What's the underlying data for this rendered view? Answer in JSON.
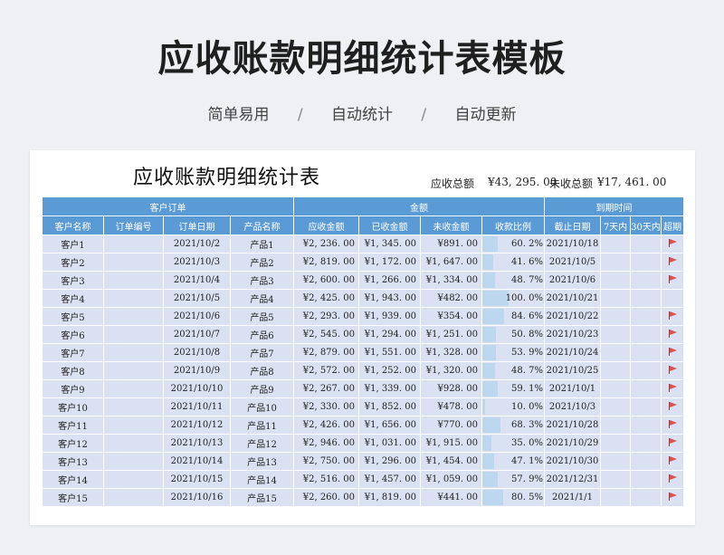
{
  "hero_title": "应收账款明细统计表模板",
  "subtitle": [
    "简单易用",
    "自动统计",
    "自动更新"
  ],
  "subtitle_sep": "/",
  "sheet": {
    "title": "应收账款明细统计表",
    "total_label": "应收总额",
    "total_value": "¥43, 295. 00",
    "unpaid_label": "未收总额",
    "unpaid_value": "¥17, 461. 00"
  },
  "groups": [
    "客户订单",
    "金额",
    "到期时间"
  ],
  "headers": [
    "客户名称",
    "订单编号",
    "订单日期",
    "产品名称",
    "应收金额",
    "已收金额",
    "未收金额",
    "收款比例",
    "截止日期",
    "7天内",
    "30天内",
    "超期"
  ],
  "colors": {
    "header_bg": "#5b9bd5",
    "row_bg": "#d9e1f2",
    "bar": "#bdd7ee",
    "flag": "#d9534f"
  },
  "rows": [
    {
      "customer": "客户1",
      "order_no": "",
      "date": "2021/10/2",
      "product": "产品1",
      "due": "¥2, 236. 00",
      "paid": "¥1, 345. 00",
      "unpaid": "¥891. 00",
      "ratio": "60. 2%",
      "ratio_value": 60.2,
      "deadline": "2021/10/18",
      "overdue": true
    },
    {
      "customer": "客户2",
      "order_no": "",
      "date": "2021/10/3",
      "product": "产品2",
      "due": "¥2, 819. 00",
      "paid": "¥1, 172. 00",
      "unpaid": "¥1, 647. 00",
      "ratio": "41. 6%",
      "ratio_value": 41.6,
      "deadline": "2021/10/5",
      "overdue": true
    },
    {
      "customer": "客户3",
      "order_no": "",
      "date": "2021/10/4",
      "product": "产品3",
      "due": "¥2, 600. 00",
      "paid": "¥1, 266. 00",
      "unpaid": "¥1, 334. 00",
      "ratio": "48. 7%",
      "ratio_value": 48.7,
      "deadline": "2021/10/6",
      "overdue": true
    },
    {
      "customer": "客户4",
      "order_no": "",
      "date": "2021/10/5",
      "product": "产品4",
      "due": "¥2, 425. 00",
      "paid": "¥1, 943. 00",
      "unpaid": "¥482. 00",
      "ratio": "100. 0%",
      "ratio_value": 100.0,
      "deadline": "2021/10/21",
      "overdue": false
    },
    {
      "customer": "客户5",
      "order_no": "",
      "date": "2021/10/6",
      "product": "产品5",
      "due": "¥2, 293. 00",
      "paid": "¥1, 939. 00",
      "unpaid": "¥354. 00",
      "ratio": "84. 6%",
      "ratio_value": 84.6,
      "deadline": "2021/10/22",
      "overdue": true
    },
    {
      "customer": "客户6",
      "order_no": "",
      "date": "2021/10/7",
      "product": "产品6",
      "due": "¥2, 545. 00",
      "paid": "¥1, 294. 00",
      "unpaid": "¥1, 251. 00",
      "ratio": "50. 8%",
      "ratio_value": 50.8,
      "deadline": "2021/10/23",
      "overdue": true
    },
    {
      "customer": "客户7",
      "order_no": "",
      "date": "2021/10/8",
      "product": "产品7",
      "due": "¥2, 879. 00",
      "paid": "¥1, 551. 00",
      "unpaid": "¥1, 328. 00",
      "ratio": "53. 9%",
      "ratio_value": 53.9,
      "deadline": "2021/10/24",
      "overdue": true
    },
    {
      "customer": "客户8",
      "order_no": "",
      "date": "2021/10/9",
      "product": "产品8",
      "due": "¥2, 572. 00",
      "paid": "¥1, 252. 00",
      "unpaid": "¥1, 320. 00",
      "ratio": "48. 7%",
      "ratio_value": 48.7,
      "deadline": "2021/10/25",
      "overdue": true
    },
    {
      "customer": "客户9",
      "order_no": "",
      "date": "2021/10/10",
      "product": "产品9",
      "due": "¥2, 267. 00",
      "paid": "¥1, 339. 00",
      "unpaid": "¥928. 00",
      "ratio": "59. 1%",
      "ratio_value": 59.1,
      "deadline": "2021/10/1",
      "overdue": true
    },
    {
      "customer": "客户10",
      "order_no": "",
      "date": "2021/10/11",
      "product": "产品10",
      "due": "¥2, 330. 00",
      "paid": "¥1, 852. 00",
      "unpaid": "¥478. 00",
      "ratio": "10. 0%",
      "ratio_value": 10.0,
      "deadline": "2021/10/3",
      "overdue": true
    },
    {
      "customer": "客户11",
      "order_no": "",
      "date": "2021/10/12",
      "product": "产品11",
      "due": "¥2, 426. 00",
      "paid": "¥1, 656. 00",
      "unpaid": "¥770. 00",
      "ratio": "68. 3%",
      "ratio_value": 68.3,
      "deadline": "2021/10/28",
      "overdue": true
    },
    {
      "customer": "客户12",
      "order_no": "",
      "date": "2021/10/13",
      "product": "产品12",
      "due": "¥2, 946. 00",
      "paid": "¥1, 031. 00",
      "unpaid": "¥1, 915. 00",
      "ratio": "35. 0%",
      "ratio_value": 35.0,
      "deadline": "2021/10/29",
      "overdue": true
    },
    {
      "customer": "客户13",
      "order_no": "",
      "date": "2021/10/14",
      "product": "产品13",
      "due": "¥2, 750. 00",
      "paid": "¥1, 296. 00",
      "unpaid": "¥1, 454. 00",
      "ratio": "47. 1%",
      "ratio_value": 47.1,
      "deadline": "2021/10/30",
      "overdue": true
    },
    {
      "customer": "客户14",
      "order_no": "",
      "date": "2021/10/15",
      "product": "产品14",
      "due": "¥2, 516. 00",
      "paid": "¥1, 457. 00",
      "unpaid": "¥1, 059. 00",
      "ratio": "57. 9%",
      "ratio_value": 57.9,
      "deadline": "2021/12/31",
      "overdue": true
    },
    {
      "customer": "客户15",
      "order_no": "",
      "date": "2021/10/16",
      "product": "产品15",
      "due": "¥2, 260. 00",
      "paid": "¥1, 819. 00",
      "unpaid": "¥441. 00",
      "ratio": "80. 5%",
      "ratio_value": 80.5,
      "deadline": "2021/1/1",
      "overdue": true
    }
  ]
}
